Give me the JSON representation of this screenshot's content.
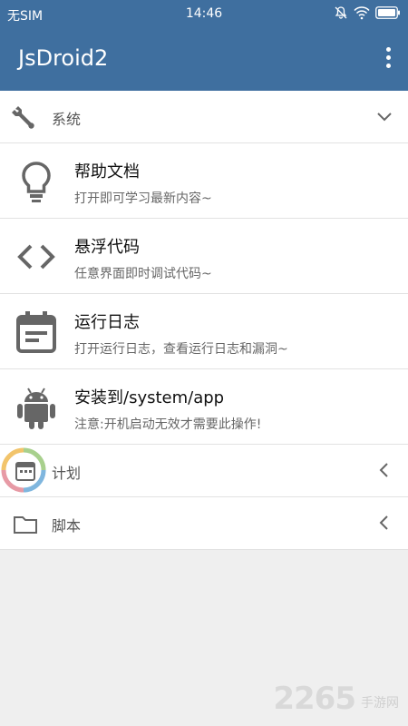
{
  "status_bar": {
    "carrier": "无SIM",
    "time": "14:46",
    "icons": [
      "mute-bell-icon",
      "wifi-icon",
      "battery-icon"
    ]
  },
  "app_bar": {
    "title": "JsDroid2",
    "menu_icon": "overflow-menu-icon"
  },
  "groups": {
    "system": {
      "label": "系统",
      "icon": "wrench-icon",
      "chevron": "chevron-down-icon"
    },
    "plan": {
      "label": "计划",
      "icon": "calendar-icon",
      "chevron": "chevron-left-icon"
    },
    "script": {
      "label": "脚本",
      "icon": "folder-icon",
      "chevron": "chevron-left-icon"
    }
  },
  "items": [
    {
      "title": "帮助文档",
      "subtitle": "打开即可学习最新内容~",
      "icon": "lightbulb-icon"
    },
    {
      "title": "悬浮代码",
      "subtitle": "任意界面即时调试代码~",
      "icon": "code-brackets-icon"
    },
    {
      "title": "运行日志",
      "subtitle": "打开运行日志，查看运行日志和漏洞~",
      "icon": "log-calendar-icon"
    },
    {
      "title": "安装到/system/app",
      "subtitle": "注意:开机启动无效才需要此操作!",
      "icon": "android-icon"
    }
  ],
  "watermark": {
    "number": "2265",
    "suffix": "手游网"
  },
  "colors": {
    "primary": "#3f6f9f",
    "divider": "#e2e2e2",
    "background": "#efefef",
    "icon_gray": "#666666"
  }
}
